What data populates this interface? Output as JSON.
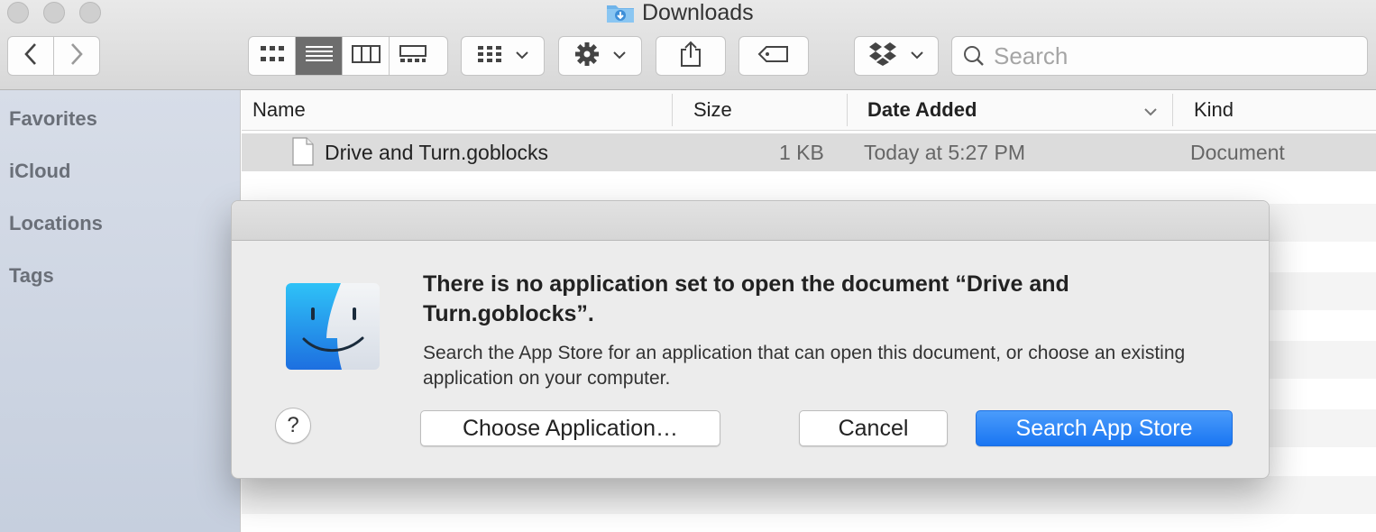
{
  "window": {
    "title": "Downloads"
  },
  "toolbar": {
    "view_modes": [
      "icon-view",
      "list-view",
      "column-view",
      "gallery-view"
    ],
    "active_view": "list-view",
    "search_placeholder": "Search"
  },
  "sidebar": {
    "items": [
      {
        "label": "Favorites"
      },
      {
        "label": "iCloud"
      },
      {
        "label": "Locations"
      },
      {
        "label": "Tags"
      }
    ]
  },
  "columns": {
    "name": "Name",
    "size": "Size",
    "date_added": "Date Added",
    "kind": "Kind"
  },
  "files": [
    {
      "name": "Drive and Turn.goblocks",
      "size": "1 KB",
      "date_added": "Today at 5:27 PM",
      "kind": "Document"
    }
  ],
  "dialog": {
    "heading": "There is no application set to open the document “Drive and Turn.goblocks”.",
    "body": "Search the App Store for an application that can open this document, or choose an existing application on your computer.",
    "help_label": "?",
    "choose_label": "Choose Application…",
    "cancel_label": "Cancel",
    "search_label": "Search App Store"
  },
  "colors": {
    "accent": "#1a76f2",
    "sidebar": "#c6cfde",
    "selected_row": "#dcdcdc"
  }
}
